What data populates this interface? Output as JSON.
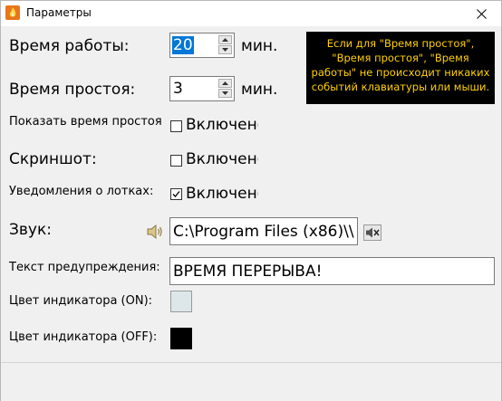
{
  "window": {
    "title": "Параметры"
  },
  "fields": {
    "work_time": {
      "label": "Время работы:",
      "value": "20",
      "unit": "мин."
    },
    "idle_time": {
      "label": "Время простоя:",
      "value": "3",
      "unit": "мин."
    },
    "show_idle": {
      "label": "Показать время простоя",
      "checkbox_label": "Включено",
      "checked": false
    },
    "screenshot": {
      "label": "Скриншот:",
      "checkbox_label": "Включено",
      "checked": false
    },
    "tray_notifications": {
      "label": "Уведомления о лотках:",
      "checkbox_label": "Включено",
      "checked": true
    },
    "sound": {
      "label": "Звук:",
      "path": "C:\\Program Files (x86)\\\\"
    },
    "warning_text": {
      "label": "Текст предупреждения:",
      "value": "ВРЕМЯ ПЕРЕРЫВА!"
    },
    "indicator_on": {
      "label": "Цвет индикатора (ON):",
      "color": "#dde7ea"
    },
    "indicator_off": {
      "label": "Цвет индикатора (OFF):",
      "color": "#000000"
    }
  },
  "tooltip": {
    "text": "Если для \"Время простоя\", \"Время простоя\", \"Время работы\" не происходит никаких событий клавиатуры или мыши."
  },
  "colors": {
    "tooltip_bg": "#000000",
    "tooltip_fg": "#ffd000",
    "selection": "#0078d7"
  }
}
